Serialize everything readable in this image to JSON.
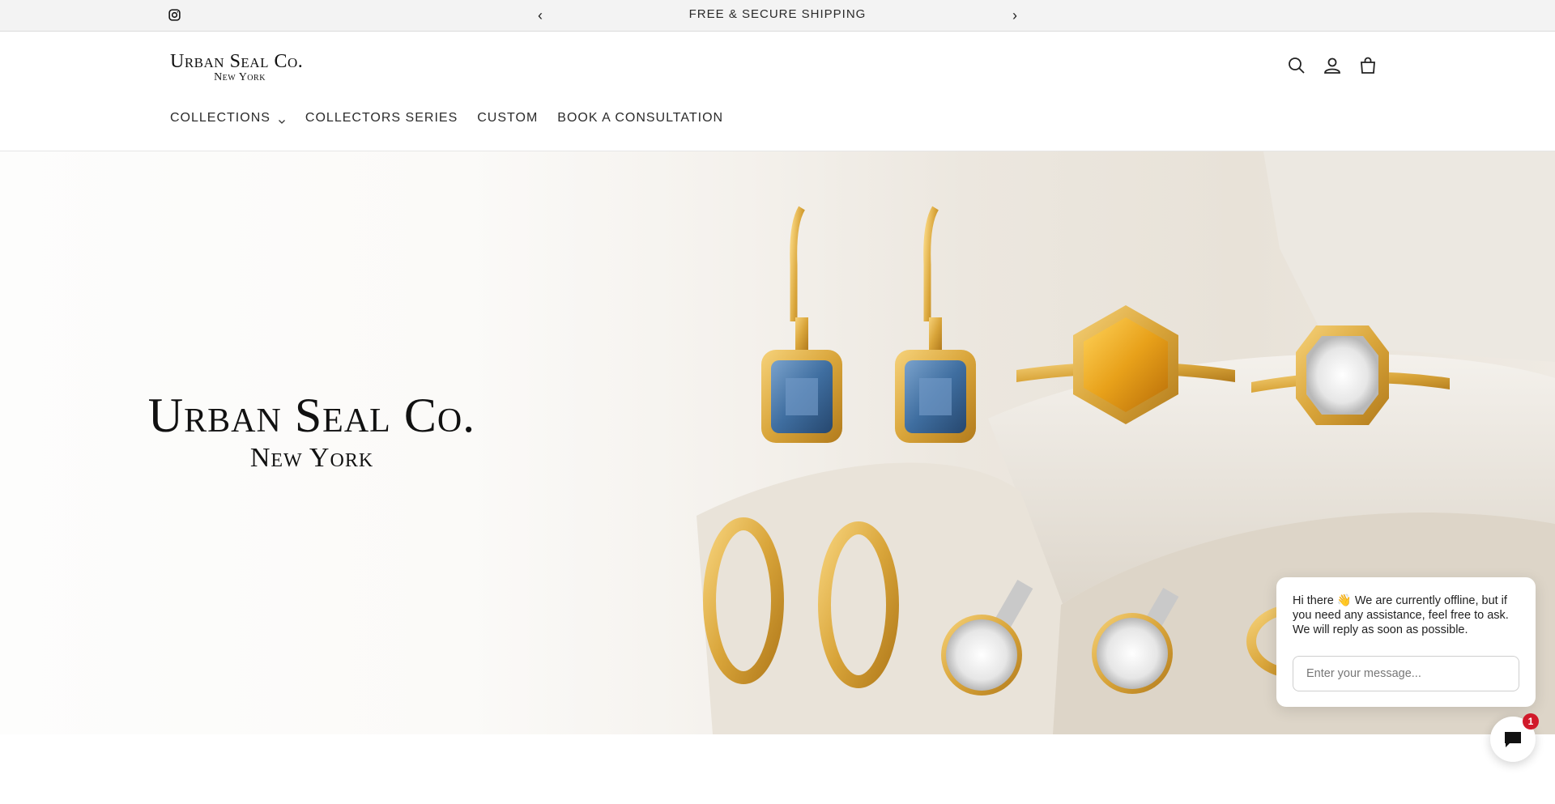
{
  "announcement": {
    "message": "FREE & SECURE SHIPPING",
    "prev_icon": "‹",
    "next_icon": "›"
  },
  "header": {
    "logo_line1": "Urban Seal Co.",
    "logo_line2": "New York",
    "icons": [
      "search-icon",
      "account-icon",
      "cart-icon"
    ]
  },
  "nav": {
    "items": [
      {
        "label": "COLLECTIONS",
        "has_dropdown": true
      },
      {
        "label": "COLLECTORS SERIES"
      },
      {
        "label": "CUSTOM"
      },
      {
        "label": "BOOK A CONSULTATION"
      }
    ]
  },
  "hero": {
    "title_line1": "Urban Seal Co.",
    "title_line2": "New York"
  },
  "chat": {
    "message": "Hi there 👋 We are currently offline, but if you need any assistance, feel free to ask. We will reply as soon as possible.",
    "input_placeholder": "Enter your message...",
    "badge_count": "1"
  },
  "colors": {
    "announcement_bg": "#f3f3f3",
    "gold": "#d9a53a",
    "blue_gem": "#3f6ea0",
    "citrine": "#e8a11a",
    "badge": "#d11a2a"
  }
}
